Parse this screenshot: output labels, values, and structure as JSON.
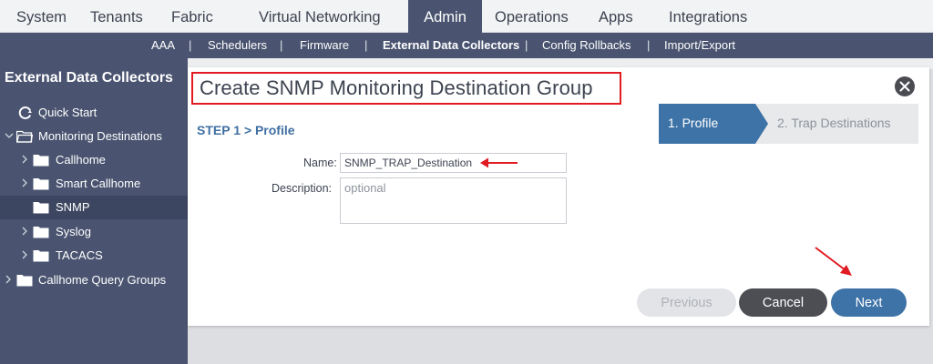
{
  "top_nav": {
    "tabs": [
      {
        "label": "System"
      },
      {
        "label": "Tenants"
      },
      {
        "label": "Fabric"
      },
      {
        "label": "Virtual Networking"
      },
      {
        "label": "Admin",
        "active": true
      },
      {
        "label": "Operations"
      },
      {
        "label": "Apps"
      },
      {
        "label": "Integrations"
      }
    ]
  },
  "sub_nav": {
    "items": [
      {
        "label": "AAA"
      },
      {
        "label": "Schedulers"
      },
      {
        "label": "Firmware"
      },
      {
        "label": "External Data Collectors",
        "active": true
      },
      {
        "label": "Config Rollbacks"
      },
      {
        "label": "Import/Export"
      }
    ],
    "separator": "|"
  },
  "sidebar": {
    "title": "External Data Collectors",
    "items": [
      {
        "label": "Quick Start",
        "icon": "quick-start-icon"
      },
      {
        "label": "Monitoring Destinations",
        "icon": "folder-icon",
        "expanded": true
      },
      {
        "label": "Callhome",
        "icon": "folder-icon"
      },
      {
        "label": "Smart Callhome",
        "icon": "folder-icon"
      },
      {
        "label": "SNMP",
        "icon": "folder-icon",
        "selected": true
      },
      {
        "label": "Syslog",
        "icon": "folder-icon"
      },
      {
        "label": "TACACS",
        "icon": "folder-icon"
      },
      {
        "label": "Callhome Query Groups",
        "icon": "folder-icon"
      }
    ]
  },
  "dialog": {
    "title": "Create SNMP Monitoring Destination Group",
    "step_heading": "STEP 1 > Profile",
    "wizard": {
      "step1": "1. Profile",
      "step2": "2. Trap Destinations"
    },
    "form": {
      "name_label": "Name:",
      "name_value": "SNMP_TRAP_Destination",
      "description_label": "Description:",
      "description_placeholder": "optional"
    },
    "buttons": {
      "previous": "Previous",
      "cancel": "Cancel",
      "next": "Next"
    }
  },
  "colors": {
    "nav_dark": "#4a5470",
    "accent_blue": "#3e73a7",
    "annotation_red": "#e11b22"
  }
}
